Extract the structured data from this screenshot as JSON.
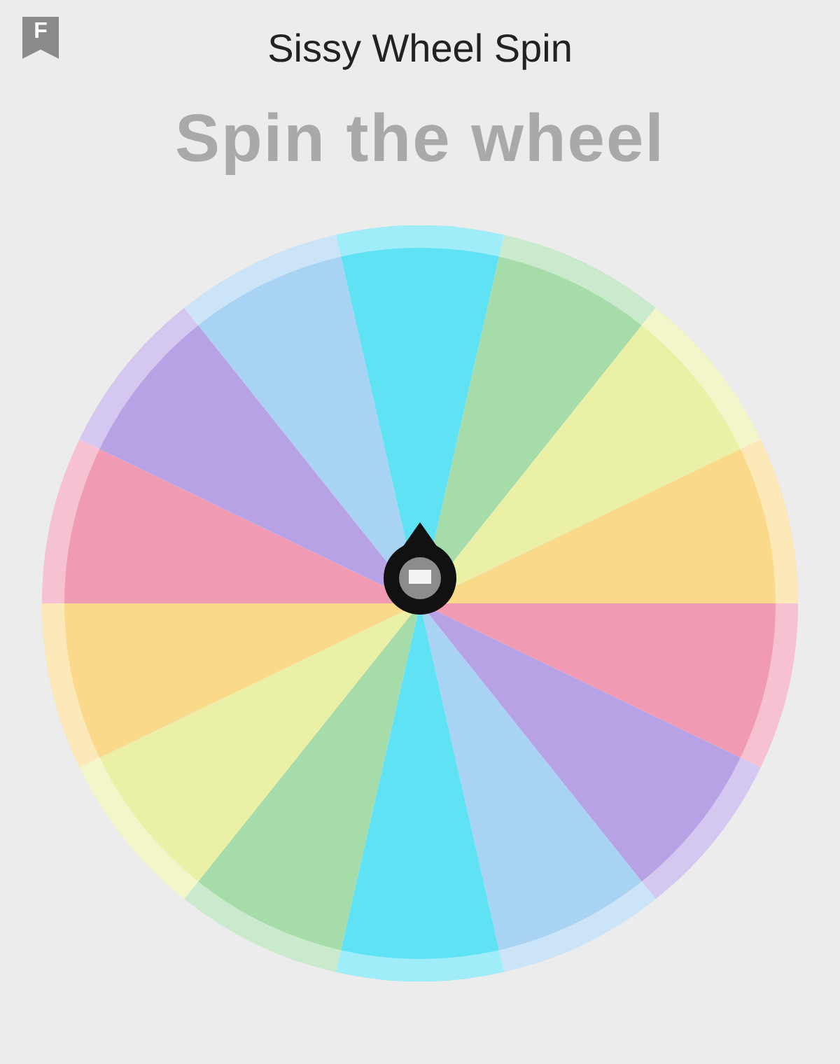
{
  "app_badge": {
    "letter": "F"
  },
  "window": {
    "title": "Sissy Wheel Spin"
  },
  "heading": "Spin the wheel",
  "wheel": {
    "segments": [
      {
        "color": "#5fe2f4"
      },
      {
        "color": "#a6dcaa"
      },
      {
        "color": "#eaf0a6"
      },
      {
        "color": "#fbd98a"
      },
      {
        "color": "#f19ab3"
      },
      {
        "color": "#b8a2e6"
      },
      {
        "color": "#a9d3f3"
      },
      {
        "color": "#5fe2f4"
      },
      {
        "color": "#a6dcaa"
      },
      {
        "color": "#eaf0a6"
      },
      {
        "color": "#fbd98a"
      },
      {
        "color": "#f19ab3"
      },
      {
        "color": "#b8a2e6"
      },
      {
        "color": "#a9d3f3"
      }
    ]
  }
}
